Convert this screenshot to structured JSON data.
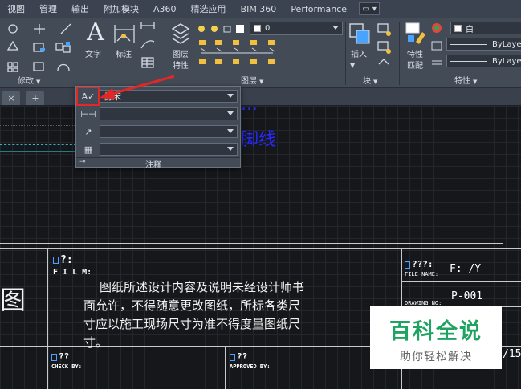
{
  "menu": {
    "items": [
      "视图",
      "管理",
      "输出",
      "附加模块",
      "A360",
      "精选应用",
      "BIM 360",
      "Performance"
    ],
    "control_glyph": "▭ ▾"
  },
  "ribbon": {
    "modify_panel_label": "修改",
    "text_label": "文字",
    "dim_label": "标注",
    "annotation_panel_label": "注释",
    "layer_props_label_1": "图层",
    "layer_props_label_2": "特性",
    "layer_panel_label": "图层",
    "layer_current": "0",
    "insert_label": "插入",
    "block_panel_label": "块",
    "match_label_1": "特性",
    "match_label_2": "匹配",
    "color_value": "白",
    "linetype_value": "ByLaye",
    "lineweight_value": "ByLaye",
    "properties_panel_label": "特性"
  },
  "tabs": {
    "close_glyph": "×",
    "new_tab_glyph": "+"
  },
  "annotation_flyout": {
    "text_style": "仿宋",
    "dim_style": "",
    "leader_style": "",
    "table_style": "",
    "footer_label": "注释"
  },
  "drawing": {
    "heading_line1": "...",
    "heading_line2": "脚线",
    "film_label": "F I L M:",
    "qmark_1": "?:",
    "note_lines": [
      "图纸所述设计内容及说明未经设计师书",
      "面允许，不得随意更改图纸，所标各类尺",
      "寸应以施工现场尺寸为准不得度量图纸尺",
      "寸。"
    ],
    "left_char": "图",
    "qq_label": "???:",
    "file_name_label": "FILE NAME:",
    "file_name_value": "F: /Y",
    "drawing_no_label": "DRAWING NO:",
    "drawing_no_value": "P-001",
    "check_label": "CHECK BY:",
    "approved_label": "APPROVED BY:",
    "page_fragment": "/15"
  },
  "watermark": {
    "title": "百科全说",
    "subtitle": "助你轻松解决"
  },
  "colors": {
    "ribbon_bg": "#434b57",
    "canvas_bg": "#15171b",
    "highlight_red": "#e32626",
    "heading_blue": "#2828ff",
    "watermark_green": "#1fa363"
  }
}
